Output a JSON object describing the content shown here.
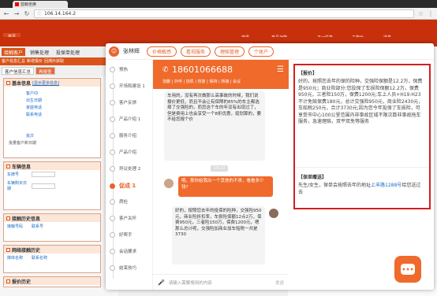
{
  "browser": {
    "tab_title": "蓝鲸坐席",
    "url": "106.14.164.2",
    "back_icon": "back-arrow-icon",
    "forward_icon": "forward-arrow-icon",
    "reload_icon": "reload-icon"
  },
  "app": {
    "home_label": "首页",
    "header_links": [
      "商讯",
      "产品功能",
      "下一任务",
      "工作台",
      "消息"
    ],
    "nav_main": [
      "接触客户",
      "销售处理",
      "投保单处理"
    ],
    "nav_sub": [
      "客户信息汇总",
      "新增报价",
      "回溯外获取"
    ],
    "crumbs": [
      "客户信息汇总",
      "再报查"
    ]
  },
  "left_panel": {
    "basic_info": {
      "title": "基本信息",
      "link": "[显示更多信息]",
      "rows": [
        "客户ID",
        "出生日期",
        "家庭电话",
        "联系电话"
      ],
      "extra_a": "批次",
      "extra_b": "批量客户新日期"
    },
    "vehicle_info": {
      "title": "车辆信息",
      "fields": [
        "车牌号",
        "车辆购买日期"
      ]
    },
    "contact_history": {
      "title": "接触历史信息",
      "fields": [
        "接触号码",
        "联系号"
      ]
    },
    "online_history": {
      "title": "网络接触历史",
      "fields": [
        "媒体名称",
        "联系名称"
      ]
    },
    "quote_history": {
      "title": "报价历史"
    }
  },
  "modal": {
    "agent_name": "张林辉",
    "tags": [
      "价格敏感",
      "看视服务",
      "理赔管理",
      "个体户"
    ],
    "timeline": [
      {
        "label": "预热",
        "active": false
      },
      {
        "label": "开场和建设 1",
        "active": false
      },
      {
        "label": "客户反馈",
        "active": false
      },
      {
        "label": "产品介绍 1",
        "active": false
      },
      {
        "label": "服务介绍",
        "active": false
      },
      {
        "label": "产品介绍",
        "active": false
      },
      {
        "label": "异议处理 2",
        "active": false
      },
      {
        "label": "促成 1",
        "active": true
      },
      {
        "label": "质检",
        "active": false
      },
      {
        "label": "客户关怀",
        "active": false
      },
      {
        "label": "好帮手",
        "active": false
      },
      {
        "label": "会话要求",
        "active": false
      },
      {
        "label": "结束技巧",
        "active": false
      }
    ],
    "phone": "18601066688",
    "phone_links": "加删 | 外呼 | 挂机 | 恢复 | 保持 | 转接 | 会议",
    "msg_top": "车用的，没有再次做那么高事故的时候，我们说报价更低，而且不会让有保障的85%的车主都选择了交强险的，而您这个车的年没有出现过了，但是费用上也会享受一个8折优惠，挺划算的，要不给您报个价",
    "timestamp": "19:22",
    "msg_user": "哦，那你给我出一个其他的不贵，看看多少钱?",
    "msg_bottom": "好的，按照您去年的投保的险种，交强险950元，商业险折扣率，车损险保额12点2万，保费950元，三者险150万，保费1200元，嗯那么总计呢，交强险加商业加车船税一共是3730",
    "input_placeholder": "请输入需要搜用的内容",
    "send_label": "发送"
  },
  "knowledge": {
    "quote_title": "【报价】",
    "quote_body": "好的，按照您去年的保的险种，交强险保额是12.2万，保费是950元；商业险部分:您投保了车损险保额12.2万，保费950元，三者险150万，保费1200元;车上人员+H19:H23不计免赔保费180元，总计交强险950元，商业险2430元，车船税250元，合计3730元;因为您今年投保了车损险，可享受市中心100公里范围内非事故区域不限次数非事故拖车服务，急速理赔，双平双免等服务",
    "gift_title": "【保单赠送】",
    "gift_body_a": "先生/女生，保单会按照去年的地址",
    "gift_link": "上丰路1288号",
    "gift_body_b": "给您送过去"
  }
}
